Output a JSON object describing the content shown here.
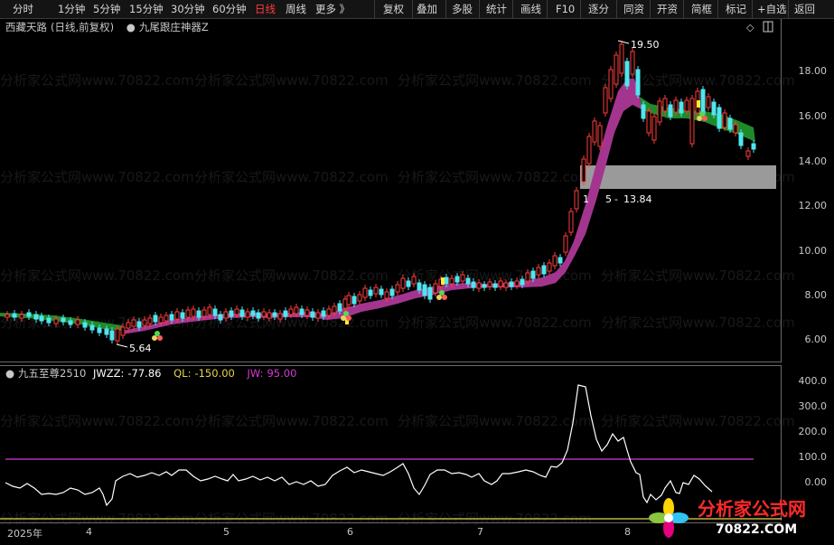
{
  "toolbar": {
    "left": [
      "分时",
      "1分钟",
      "5分钟",
      "15分钟",
      "30分钟",
      "60分钟",
      "日线",
      "周线",
      "更多 》"
    ],
    "active": "日线",
    "right": [
      "复权",
      "叠加",
      "多股",
      "统计",
      "画线",
      "F10",
      "逐分",
      "同资",
      "开资",
      "简框",
      "标记",
      "+自选",
      "返回"
    ]
  },
  "main_panel": {
    "stock_name": "西藏天路",
    "mode": "(日线,前复权)",
    "indicator": "九尾跟庄神器Z",
    "y_axis": [
      "18.00",
      "16.00",
      "14.00",
      "12.00",
      "10.00",
      "8.00",
      "6.00"
    ],
    "annotations": {
      "high": "19.50",
      "low": "5.64",
      "band": "13.84"
    },
    "band_text_prefix": "1",
    "band_text_mid": "5",
    "colors": {
      "up": "#ff3b3b",
      "down": "#4fe6f0",
      "ribbon_up": "#a4358e",
      "ribbon_down": "#1f8a2a",
      "band": "#9a9a9a"
    }
  },
  "sub_panel": {
    "name": "九五至尊2510",
    "jwzz_label": "JWZZ:",
    "jwzz_value": "-77.86",
    "ql_label": "QL:",
    "ql_value": "-150.00",
    "jw_label": "JW:",
    "jw_value": "95.00",
    "y_axis": [
      "400.0",
      "300.0",
      "200.0",
      "100.0",
      "0.00"
    ],
    "colors": {
      "jwzz": "#ffffff",
      "ql": "#e6d64a",
      "jw": "#d23ad2"
    }
  },
  "x_axis": [
    "2025年",
    "4",
    "5",
    "6",
    "7",
    "8"
  ],
  "watermark": "分析家公式网www.70822.com",
  "logo": {
    "title": "分析家公式网",
    "url": "70822.COM"
  }
}
